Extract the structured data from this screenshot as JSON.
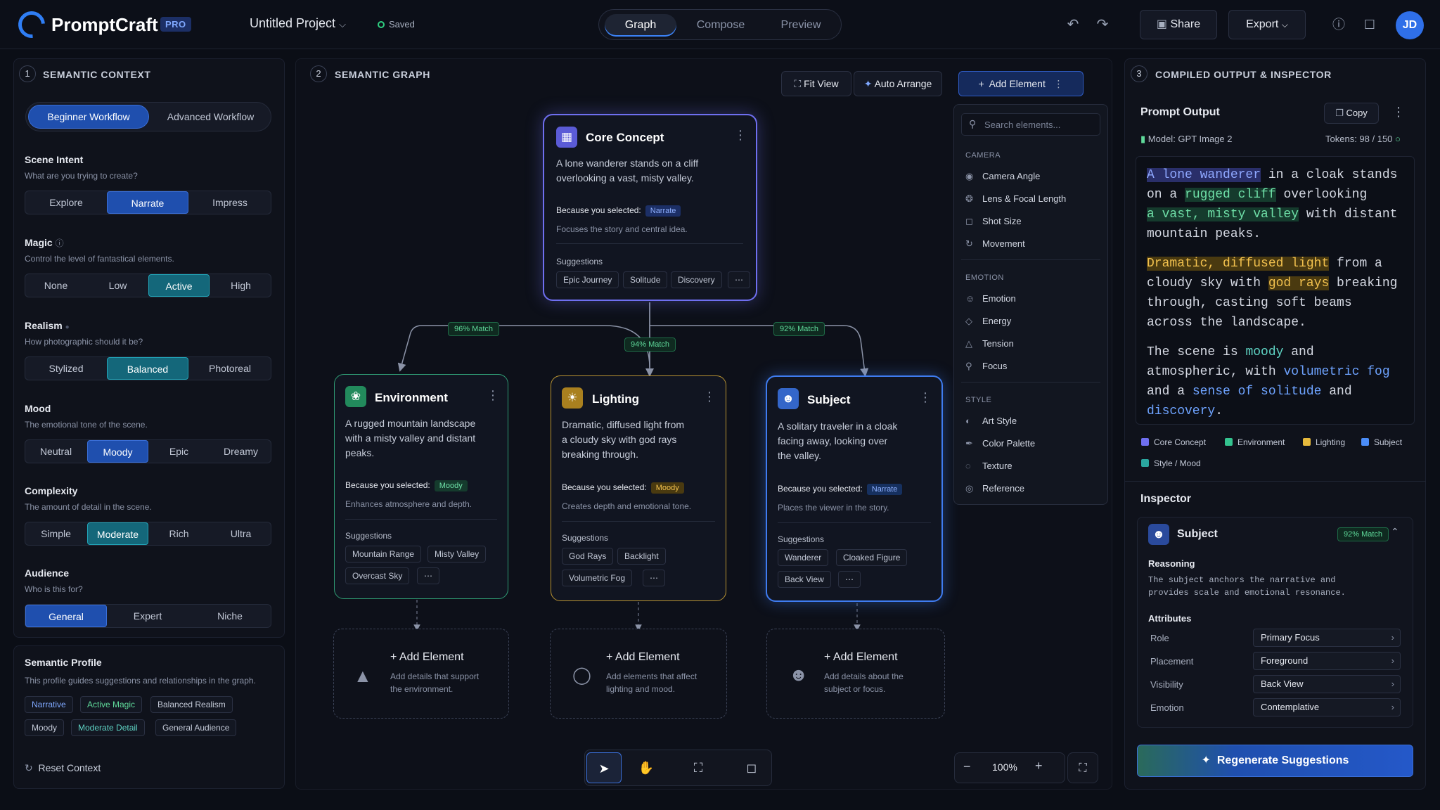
{
  "app": {
    "brand": "PromptCraft",
    "badge": "PRO",
    "project": "Untitled Project",
    "saved": "Saved",
    "avatar": "JD"
  },
  "modes": [
    "Graph",
    "Compose",
    "Preview"
  ],
  "actions": {
    "share": "Share",
    "export": "Export"
  },
  "left": {
    "num": "1",
    "title": "SEMANTIC CONTEXT",
    "workflows": [
      "Beginner Workflow",
      "Advanced Workflow"
    ],
    "scene": {
      "label": "Scene Intent",
      "sub": "What are you trying to create?",
      "options": [
        "Explore",
        "Narrate",
        "Impress"
      ]
    },
    "magic": {
      "label": "Magic",
      "sub": "Control the level of fantastical elements.",
      "options": [
        "None",
        "Low",
        "Active",
        "High"
      ]
    },
    "realism": {
      "label": "Realism",
      "sub": "How photographic should it be?",
      "options": [
        "Stylized",
        "Balanced",
        "Photoreal"
      ]
    },
    "mood": {
      "label": "Mood",
      "sub": "The emotional tone of the scene.",
      "options": [
        "Neutral",
        "Moody",
        "Epic",
        "Dreamy"
      ]
    },
    "complexity": {
      "label": "Complexity",
      "sub": "The amount of detail in the scene.",
      "options": [
        "Simple",
        "Moderate",
        "Rich",
        "Ultra"
      ]
    },
    "audience": {
      "label": "Audience",
      "sub": "Who is this for?",
      "options": [
        "General",
        "Expert",
        "Niche"
      ]
    },
    "profile": {
      "title": "Semantic Profile",
      "sub": "This profile guides suggestions and relationships in the graph.",
      "chips": [
        "Narrative",
        "Active Magic",
        "Balanced Realism",
        "Moody",
        "Moderate Detail",
        "General Audience"
      ]
    },
    "reset": "Reset Context"
  },
  "graph": {
    "num": "2",
    "title": "SEMANTIC GRAPH",
    "tools": {
      "fit": "Fit View",
      "arrange": "Auto Arrange",
      "add": "Add Element"
    },
    "search_placeholder": "Search elements...",
    "library": {
      "camera": {
        "title": "CAMERA",
        "items": [
          "Camera Angle",
          "Lens & Focal Length",
          "Shot Size",
          "Movement"
        ]
      },
      "emotion": {
        "title": "EMOTION",
        "items": [
          "Emotion",
          "Energy",
          "Tension",
          "Focus"
        ]
      },
      "style": {
        "title": "STYLE",
        "items": [
          "Art Style",
          "Color Palette",
          "Texture",
          "Reference"
        ]
      }
    },
    "core": {
      "title": "Core Concept",
      "text1": "A lone wanderer stands on a cliff",
      "text2": "overlooking a vast, misty valley.",
      "because": "Because you selected:",
      "tag": "Narrate",
      "note": "Focuses the story and central idea.",
      "sugg": "Suggestions",
      "chips": [
        "Epic Journey",
        "Solitude",
        "Discovery"
      ]
    },
    "env": {
      "title": "Environment",
      "text1": "A rugged mountain landscape",
      "text2": "with a misty valley and distant",
      "text3": "peaks.",
      "because": "Because you selected:",
      "tag": "Moody",
      "note": "Enhances atmosphere and depth.",
      "sugg": "Suggestions",
      "chips": [
        "Mountain Range",
        "Misty Valley",
        "Overcast Sky"
      ]
    },
    "light": {
      "title": "Lighting",
      "text1": "Dramatic, diffused light from",
      "text2": "a cloudy sky with god rays",
      "text3": "breaking through.",
      "because": "Because you selected:",
      "tag": "Moody",
      "note": "Creates depth and emotional tone.",
      "sugg": "Suggestions",
      "chips": [
        "God Rays",
        "Backlight",
        "Volumetric Fog"
      ]
    },
    "subj": {
      "title": "Subject",
      "text1": "A solitary traveler in a cloak",
      "text2": "facing away, looking over",
      "text3": "the valley.",
      "because": "Because you selected:",
      "tag": "Narrate",
      "note": "Places the viewer in the story.",
      "sugg": "Suggestions",
      "chips": [
        "Wanderer",
        "Cloaked Figure",
        "Back View"
      ]
    },
    "matches": {
      "env": "96% Match",
      "light": "94% Match",
      "subj": "92% Match"
    },
    "adds": [
      {
        "title": "+ Add Element",
        "l1": "Add details that support",
        "l2": "the environment."
      },
      {
        "title": "+ Add Element",
        "l1": "Add elements that affect",
        "l2": "lighting and mood."
      },
      {
        "title": "+ Add Element",
        "l1": "Add details about the",
        "l2": "subject or focus."
      }
    ],
    "zoom": "100%"
  },
  "right": {
    "num": "3",
    "title": "COMPILED OUTPUT & INSPECTOR",
    "output_title": "Prompt Output",
    "copy": "Copy",
    "model": "Model: GPT Image 2",
    "tokens": "Tokens: 98 / 150",
    "legend": [
      "Core Concept",
      "Environment",
      "Lighting",
      "Subject",
      "Style / Mood"
    ],
    "inspector": "Inspector",
    "subject": "Subject",
    "match": "92% Match",
    "reasoning": "Reasoning",
    "reason1": "The subject anchors the narrative and",
    "reason2": "provides scale and emotional resonance.",
    "attributes": "Attributes",
    "attrs": [
      {
        "k": "Role",
        "v": "Primary Focus"
      },
      {
        "k": "Placement",
        "v": "Foreground"
      },
      {
        "k": "Visibility",
        "v": "Back View"
      },
      {
        "k": "Emotion",
        "v": "Contemplative"
      }
    ],
    "regen": "Regenerate Suggestions"
  },
  "colors": {
    "accent": "#3b82f6",
    "core": "#7c7cf5",
    "env": "#34c38f",
    "light": "#e6b93c",
    "subj": "#4b8df8"
  }
}
